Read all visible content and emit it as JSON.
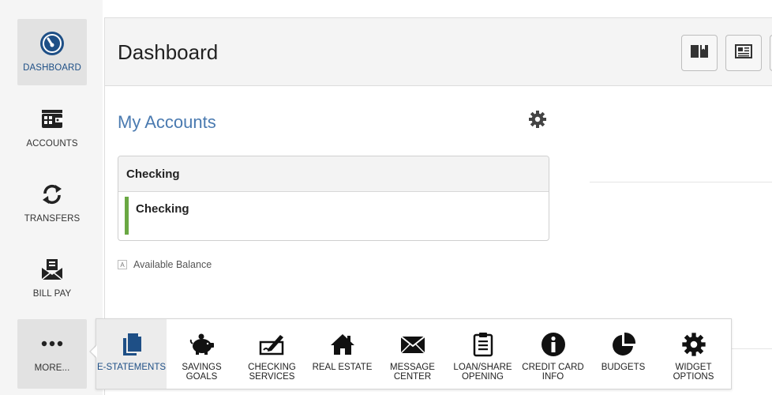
{
  "sidebar": {
    "items": [
      {
        "label": "DASHBOARD",
        "icon": "dashboard-gauge-icon",
        "active": true
      },
      {
        "label": "ACCOUNTS",
        "icon": "wallet-icon"
      },
      {
        "label": "TRANSFERS",
        "icon": "transfer-arrows-icon"
      },
      {
        "label": "BILL PAY",
        "icon": "bill-pay-envelope-icon"
      },
      {
        "label": "MORE...",
        "icon": "more-dots-icon"
      }
    ]
  },
  "header": {
    "title": "Dashboard",
    "buttons": [
      {
        "icon": "book-icon"
      },
      {
        "icon": "newspaper-icon"
      }
    ]
  },
  "accounts": {
    "title": "My Accounts",
    "settings_icon": "gear-icon",
    "group": {
      "title": "Checking",
      "rows": [
        {
          "name": "Checking",
          "accent": "#6aa843"
        }
      ]
    },
    "legend": {
      "key": "A",
      "text": "Available Balance"
    }
  },
  "more_menu": {
    "items": [
      {
        "label": "E-STATEMENTS",
        "icon": "document-icon",
        "active": true
      },
      {
        "label": "SAVINGS GOALS",
        "icon": "piggy-bank-icon"
      },
      {
        "label": "CHECKING SERVICES",
        "icon": "check-pen-icon"
      },
      {
        "label": "REAL ESTATE",
        "icon": "house-icon"
      },
      {
        "label": "MESSAGE CENTER",
        "icon": "envelope-icon"
      },
      {
        "label": "LOAN/SHARE OPENING",
        "icon": "clipboard-icon"
      },
      {
        "label": "CREDIT CARD INFO",
        "icon": "info-icon"
      },
      {
        "label": "BUDGETS",
        "icon": "pie-chart-icon"
      },
      {
        "label": "WIDGET OPTIONS",
        "icon": "gear-icon"
      }
    ]
  },
  "colors": {
    "brand_blue": "#1e4f86",
    "accent_green": "#6aa843",
    "link_blue": "#4a7ab0"
  }
}
